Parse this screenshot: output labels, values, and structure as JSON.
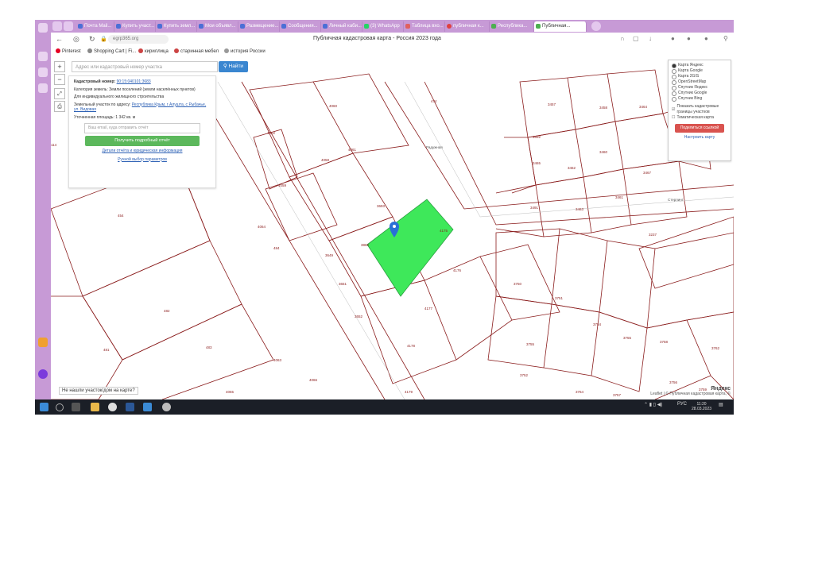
{
  "browser": {
    "tabs": [
      "Почта Mail...",
      "Купить участ...",
      "Купить земл...",
      "Мои объявл...",
      "Размещение...",
      "Сообщения...",
      "Личный каби...",
      "(3) WhatsApp",
      "Таблица вхо...",
      "публичная к...",
      "Республика...",
      "Публичная..."
    ],
    "url": "egrp365.org",
    "page_title": "Публичная кадастровая карта - Россия 2023 года"
  },
  "bookmarks": [
    "Pinterest",
    "Shopping Cart | Fi...",
    "кириллица",
    "старинная мебел",
    "история России"
  ],
  "map": {
    "search_placeholder": "Адрес или кадастровый номер участка",
    "search_button": "Найти",
    "zoom_in": "+",
    "zoom_out": "−",
    "info": {
      "cad_label": "Кадастровый номер:",
      "cad_value": "90:15:040101:3683",
      "category": "Категория земель: Земли поселений (земли населённых пунктов)",
      "use": "Для индивидуального жилищного строительства",
      "address_label": "Земельный участок по адресу:",
      "address_value": "Республика Крым, г Алушта, с Рыбачье, ул. Видовая",
      "area": "Уточненная площадь: 1 342 кв. м",
      "email_placeholder": "Ваш email, куда отправить отчёт",
      "report_button": "Получить подробный отчёт",
      "details_link": "Детали отчёта и юридическая информация",
      "manual_link": "Ручной выбор параметров"
    },
    "layers": {
      "options": [
        "Карта Яндекс",
        "Карта Google",
        "Карта 2GIS",
        "OpenStreetMap",
        "Спутник Яндекс",
        "Спутник Google",
        "Спутник Bing"
      ],
      "selected": "Карта Яндекс",
      "show_borders": "Показать кадастровые границы участков",
      "thematic": "Тематическая карта",
      "share_button": "Поделиться ссылкой",
      "setup_link": "Настроить карту"
    },
    "tooltip": "Не нашли участок/дом на карте?",
    "attribution": "Leaflet | © Публичная кадастровая карта, ©",
    "brand": "Яндекс",
    "plots": [
      "474",
      "4060",
      "4062",
      "4061",
      "3693",
      "4059",
      "4058",
      "3860",
      "3649",
      "3651",
      "3652",
      "4177",
      "4178",
      "4179",
      "4175",
      "4176",
      "3750",
      "3751",
      "3754",
      "3755",
      "3758",
      "3762",
      "3755",
      "3756",
      "3759",
      "3757",
      "3764",
      "3752",
      "482",
      "481",
      "483",
      "484",
      "4063",
      "4065",
      "4066",
      "3457",
      "3458",
      "3464",
      "3465",
      "3462",
      "3460",
      "3463",
      "3461",
      "3467",
      "3237",
      "3491",
      "3692",
      "4064",
      "454",
      "114",
      "Радужная",
      "Стерлинг"
    ],
    "selected_plot_color": "#3ee85a"
  },
  "taskbar": {
    "lang": "РУС",
    "time": "11:20",
    "date": "28.03.2023"
  }
}
